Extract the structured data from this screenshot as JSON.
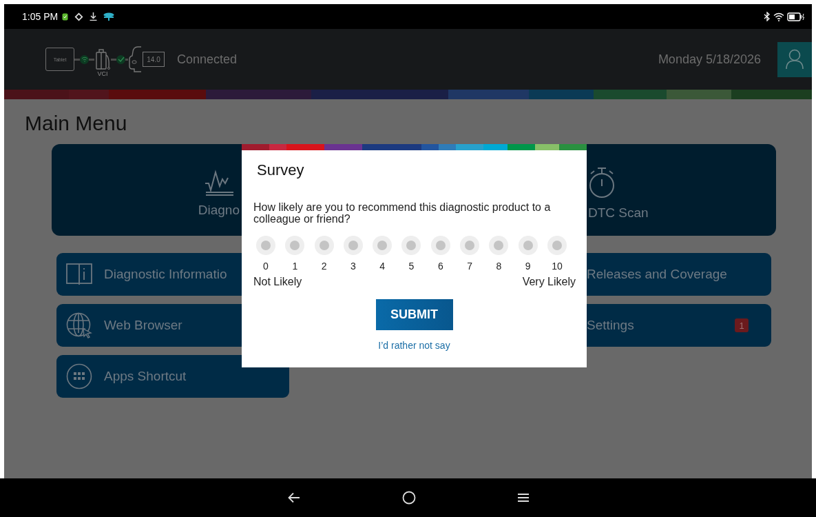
{
  "status_bar": {
    "time": "1:05 PM"
  },
  "header": {
    "connection": {
      "tablet_label": "Tablet",
      "vci_label": "VCI",
      "battery_voltage": "14.0",
      "status": "Connected"
    },
    "date": "Monday 5/18/2026"
  },
  "page_title": "Main Menu",
  "main_tiles": [
    {
      "label": "Diagno",
      "kind": "waveform"
    },
    {
      "label": "DTC Scan",
      "kind": "stopwatch"
    }
  ],
  "menu_items": [
    {
      "label": "Diagnostic Informatio",
      "kind": "book"
    },
    {
      "label": "Releases and Coverage",
      "kind": "plain"
    },
    {
      "label": "Web Browser",
      "kind": "globe"
    },
    {
      "label": "Settings",
      "kind": "plain",
      "badge": "1"
    },
    {
      "label": "Apps Shortcut",
      "kind": "apps"
    }
  ],
  "survey": {
    "title": "Survey",
    "question": "How likely are you to recommend this diagnostic product to a colleague or friend?",
    "scale": [
      {
        "label": "0",
        "selected": false
      },
      {
        "label": "1",
        "selected": false
      },
      {
        "label": "2",
        "selected": false
      },
      {
        "label": "3",
        "selected": false
      },
      {
        "label": "4",
        "selected": false
      },
      {
        "label": "5",
        "selected": false
      },
      {
        "label": "6",
        "selected": false
      },
      {
        "label": "7",
        "selected": false
      },
      {
        "label": "8",
        "selected": false
      },
      {
        "label": "9",
        "selected": false
      },
      {
        "label": "10",
        "selected": false
      }
    ],
    "low_label": "Not Likely",
    "high_label": "Very Likely",
    "submit": "SUBMIT",
    "decline": "I’d rather not say"
  }
}
